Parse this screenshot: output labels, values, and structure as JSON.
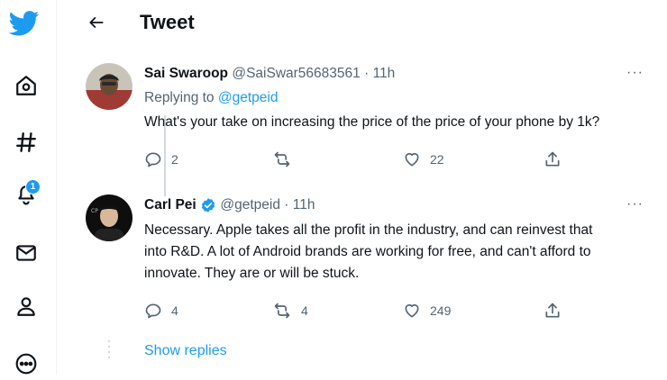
{
  "header": {
    "title": "Tweet"
  },
  "sidebar": {
    "items": [
      {
        "icon": "twitter-logo-icon"
      },
      {
        "icon": "home-icon"
      },
      {
        "icon": "explore-hashtag-icon"
      },
      {
        "icon": "notifications-bell-icon",
        "badge": "1"
      },
      {
        "icon": "messages-mail-icon"
      },
      {
        "icon": "profile-person-icon"
      },
      {
        "icon": "more-circle-icon"
      }
    ]
  },
  "tweets": [
    {
      "name": "Sai Swaroop",
      "handle": "@SaiSwar56683561",
      "separator": "·",
      "time": "11h",
      "replying_label": "Replying to",
      "replying_to": "@getpeid",
      "text": "What's your take on increasing the price of the price of your phone by 1k?",
      "replies": "2",
      "retweets": "",
      "likes": "22",
      "more": "···"
    },
    {
      "name": "Carl Pei",
      "verified": true,
      "handle": "@getpeid",
      "separator": "·",
      "time": "11h",
      "text_lines": [
        "Necessary. Apple takes all the profit in the industry, and can reinvest that",
        "into R&D. A lot of Android brands are working for free, and can't afford to",
        "innovate. They are or will be stuck."
      ],
      "replies": "4",
      "retweets": "4",
      "likes": "249",
      "more": "···"
    }
  ],
  "show_replies": "Show replies",
  "colors": {
    "accent": "#1d9bf0",
    "text": "#0f1419",
    "muted": "#536471"
  }
}
